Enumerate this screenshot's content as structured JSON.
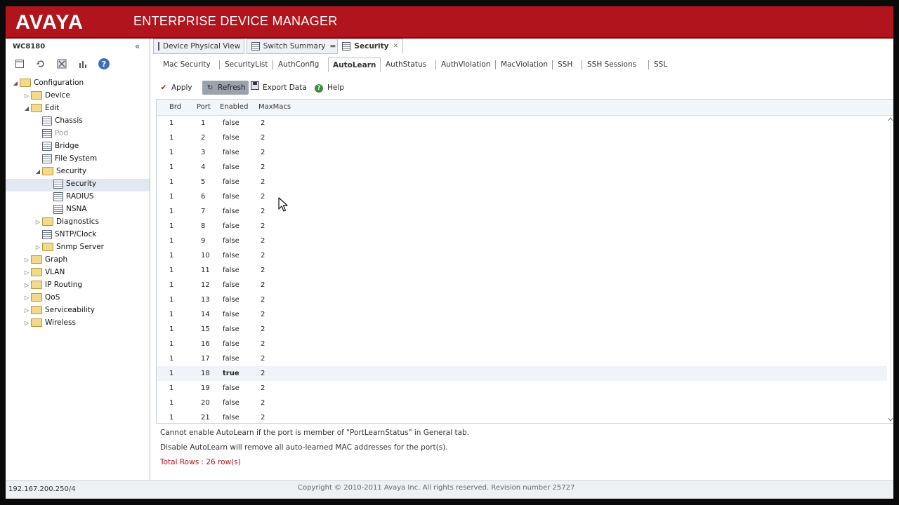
{
  "header": {
    "logo": "AVAYA",
    "title": "ENTERPRISE DEVICE MANAGER"
  },
  "left_panel": {
    "device": "WC8180",
    "collapse": "«",
    "tree": [
      {
        "label": "Configuration",
        "level": 0,
        "expanded": true,
        "type": "folder"
      },
      {
        "label": "Device",
        "level": 1,
        "expanded": false,
        "type": "folder"
      },
      {
        "label": "Edit",
        "level": 1,
        "expanded": true,
        "type": "folder"
      },
      {
        "label": "Chassis",
        "level": 2,
        "type": "page"
      },
      {
        "label": "Pod",
        "level": 2,
        "type": "page"
      },
      {
        "label": "Bridge",
        "level": 2,
        "type": "page"
      },
      {
        "label": "File System",
        "level": 2,
        "type": "page"
      },
      {
        "label": "Security",
        "level": 2,
        "expanded": true,
        "type": "folder"
      },
      {
        "label": "Security",
        "level": 3,
        "type": "page"
      },
      {
        "label": "RADIUS",
        "level": 3,
        "type": "page"
      },
      {
        "label": "NSNA",
        "level": 3,
        "type": "page"
      },
      {
        "label": "Diagnostics",
        "level": 2,
        "expanded": false,
        "type": "folder"
      },
      {
        "label": "SNTP/Clock",
        "level": 2,
        "type": "page"
      },
      {
        "label": "Snmp Server",
        "level": 2,
        "expanded": false,
        "type": "folder"
      },
      {
        "label": "Graph",
        "level": 1,
        "expanded": false,
        "type": "folder"
      },
      {
        "label": "VLAN",
        "level": 1,
        "expanded": false,
        "type": "folder"
      },
      {
        "label": "IP Routing",
        "level": 1,
        "expanded": false,
        "type": "folder"
      },
      {
        "label": "QoS",
        "level": 1,
        "expanded": false,
        "type": "folder"
      },
      {
        "label": "Serviceability",
        "level": 1,
        "expanded": false,
        "type": "folder"
      },
      {
        "label": "Wireless",
        "level": 1,
        "expanded": false,
        "type": "folder"
      }
    ]
  },
  "top_tabs": [
    {
      "label": "Device Physical View"
    },
    {
      "label": "Switch Summary"
    },
    {
      "label": "Security"
    }
  ],
  "sub_tabs": [
    "Mac Security",
    "SecurityList",
    "AuthConfig",
    "AutoLearn",
    "AuthStatus",
    "AuthViolation",
    "MacViolation",
    "SSH",
    "SSH Sessions",
    "SSL"
  ],
  "actions": {
    "apply": "Apply",
    "refresh": "Refresh",
    "export": "Export Data",
    "help": "Help"
  },
  "grid": {
    "columns": [
      "Brd",
      "Port",
      "Enabled",
      "MaxMacs"
    ],
    "rows": [
      {
        "brd": "1",
        "port": "1",
        "enabled": "false",
        "max": "2"
      },
      {
        "brd": "1",
        "port": "2",
        "enabled": "false",
        "max": "2"
      },
      {
        "brd": "1",
        "port": "3",
        "enabled": "false",
        "max": "2"
      },
      {
        "brd": "1",
        "port": "4",
        "enabled": "false",
        "max": "2"
      },
      {
        "brd": "1",
        "port": "5",
        "enabled": "false",
        "max": "2"
      },
      {
        "brd": "1",
        "port": "6",
        "enabled": "false",
        "max": "2"
      },
      {
        "brd": "1",
        "port": "7",
        "enabled": "false",
        "max": "2"
      },
      {
        "brd": "1",
        "port": "8",
        "enabled": "false",
        "max": "2"
      },
      {
        "brd": "1",
        "port": "9",
        "enabled": "false",
        "max": "2"
      },
      {
        "brd": "1",
        "port": "10",
        "enabled": "false",
        "max": "2"
      },
      {
        "brd": "1",
        "port": "11",
        "enabled": "false",
        "max": "2"
      },
      {
        "brd": "1",
        "port": "12",
        "enabled": "false",
        "max": "2"
      },
      {
        "brd": "1",
        "port": "13",
        "enabled": "false",
        "max": "2"
      },
      {
        "brd": "1",
        "port": "14",
        "enabled": "false",
        "max": "2"
      },
      {
        "brd": "1",
        "port": "15",
        "enabled": "false",
        "max": "2"
      },
      {
        "brd": "1",
        "port": "16",
        "enabled": "false",
        "max": "2"
      },
      {
        "brd": "1",
        "port": "17",
        "enabled": "false",
        "max": "2"
      },
      {
        "brd": "1",
        "port": "18",
        "enabled": "true",
        "max": "2"
      },
      {
        "brd": "1",
        "port": "19",
        "enabled": "false",
        "max": "2"
      },
      {
        "brd": "1",
        "port": "20",
        "enabled": "false",
        "max": "2"
      },
      {
        "brd": "1",
        "port": "21",
        "enabled": "false",
        "max": "2"
      }
    ]
  },
  "messages": {
    "line1": "Cannot enable AutoLearn if the port is member of \"PortLearnStatus\" in General tab.",
    "line2": "Disable AutoLearn will remove all auto-learned MAC addresses for the port(s).",
    "total": "Total Rows : 26 row(s)"
  },
  "footer": {
    "ip": "192.167.200.250/4",
    "copyright": "Copyright © 2010-2011 Avaya Inc. All rights reserved. Revision number 25727"
  },
  "colors": {
    "brand_red": "#b1141d",
    "panel_border": "#b9c4d2"
  }
}
